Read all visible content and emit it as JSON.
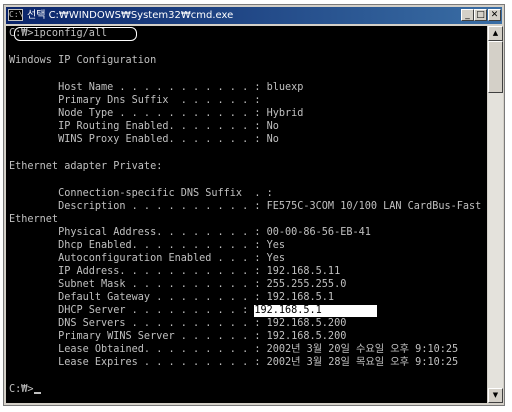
{
  "window": {
    "title": "선택 C:₩WINDOWS₩System32₩cmd.exe",
    "icon": "cmd-app-icon",
    "minimize_icon": "_",
    "maximize_icon": "□",
    "close_icon": "✕"
  },
  "console": {
    "prompt_line": "C:₩>ipconfig/all",
    "lines": [
      "Windows IP Configuration",
      "        Host Name . . . . . . . . . . . : bluexp",
      "        Primary Dns Suffix  . . . . . . :",
      "        Node Type . . . . . . . . . . . : Hybrid",
      "        IP Routing Enabled. . . . . . . : No",
      "        WINS Proxy Enabled. . . . . . . : No",
      "Ethernet adapter Private:",
      "        Connection-specific DNS Suffix  . :",
      "        Description . . . . . . . . . . : FE575C-3COM 10/100 LAN CardBus-Fast",
      "Ethernet",
      "        Physical Address. . . . . . . . : 00-00-86-56-EB-41",
      "        Dhcp Enabled. . . . . . . . . . : Yes",
      "        Autoconfiguration Enabled . . . : Yes",
      "        IP Address. . . . . . . . . . . : 192.168.5.11",
      "        Subnet Mask . . . . . . . . . . : 255.255.255.0",
      "        Default Gateway . . . . . . . . : 192.168.5.1"
    ],
    "dhcp_label": "        DHCP Server . . . . . . . . . : ",
    "dhcp_value": "192.168.5.1         ",
    "lines_after": [
      "        DNS Servers . . . . . . . . . . : 192.168.5.200",
      "        Primary WINS Server . . . . . . : 192.168.5.200",
      "        Lease Obtained. . . . . . . . . : 2002년 3월 20일 수요일 오후 9:10:25",
      "        Lease Expires . . . . . . . . . : 2002년 3월 28일 목요일 오후 9:10:25"
    ],
    "final_prompt": "C:₩>"
  },
  "scrollbar": {
    "up_icon": "▲",
    "down_icon": "▼",
    "thumb_position": 0.04
  }
}
